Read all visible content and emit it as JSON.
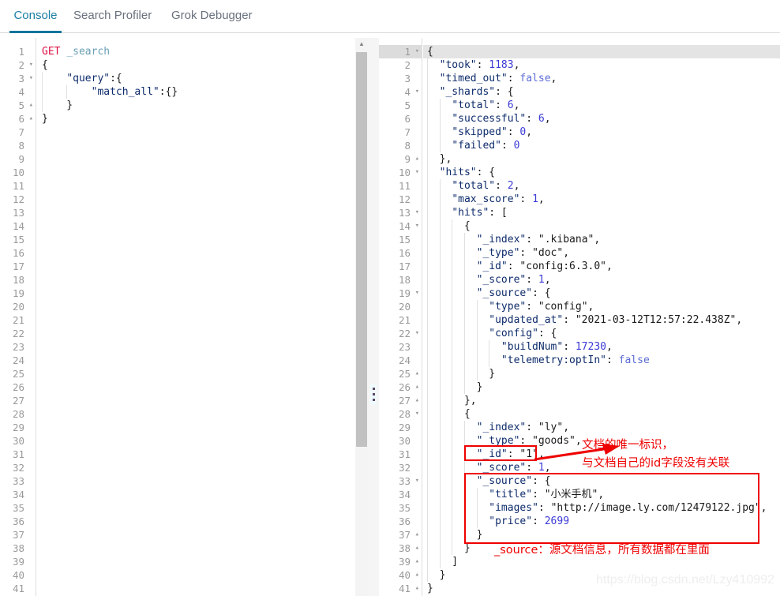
{
  "tabs": [
    {
      "label": "Console",
      "active": true
    },
    {
      "label": "Search Profiler",
      "active": false
    },
    {
      "label": "Grok Debugger",
      "active": false
    }
  ],
  "accent_color": "#0f769c",
  "annotation_color": "#ee0000",
  "request_editor": {
    "name": "console-request-editor",
    "total_lines": 41,
    "lines": [
      {
        "n": 1,
        "fold": "",
        "tokens": [
          {
            "t": "GET ",
            "c": "met"
          },
          {
            "t": "_search",
            "c": "url"
          }
        ]
      },
      {
        "n": 2,
        "fold": "▾",
        "tokens": [
          {
            "t": "{",
            "c": "p"
          }
        ]
      },
      {
        "n": 3,
        "fold": "▾",
        "tokens": [
          {
            "t": "    ",
            "c": "p"
          },
          {
            "t": "\"query\"",
            "c": "k"
          },
          {
            "t": ":{",
            "c": "p"
          }
        ]
      },
      {
        "n": 4,
        "fold": "",
        "tokens": [
          {
            "t": "        ",
            "c": "p"
          },
          {
            "t": "\"match_all\"",
            "c": "k"
          },
          {
            "t": ":{}",
            "c": "p"
          }
        ]
      },
      {
        "n": 5,
        "fold": "▴",
        "tokens": [
          {
            "t": "    }",
            "c": "p"
          }
        ]
      },
      {
        "n": 6,
        "fold": "▴",
        "tokens": [
          {
            "t": "}",
            "c": "p"
          }
        ]
      },
      {
        "n": 7,
        "fold": "",
        "tokens": []
      },
      {
        "n": 8,
        "fold": "",
        "tokens": []
      },
      {
        "n": 9,
        "fold": "",
        "tokens": []
      },
      {
        "n": 10,
        "fold": "",
        "tokens": []
      },
      {
        "n": 11,
        "fold": "",
        "tokens": []
      },
      {
        "n": 12,
        "fold": "",
        "tokens": []
      },
      {
        "n": 13,
        "fold": "",
        "tokens": []
      },
      {
        "n": 14,
        "fold": "",
        "tokens": []
      },
      {
        "n": 15,
        "fold": "",
        "tokens": []
      },
      {
        "n": 16,
        "fold": "",
        "tokens": []
      },
      {
        "n": 17,
        "fold": "",
        "tokens": []
      },
      {
        "n": 18,
        "fold": "",
        "tokens": []
      },
      {
        "n": 19,
        "fold": "",
        "tokens": []
      },
      {
        "n": 20,
        "fold": "",
        "tokens": []
      },
      {
        "n": 21,
        "fold": "",
        "tokens": []
      },
      {
        "n": 22,
        "fold": "",
        "tokens": []
      },
      {
        "n": 23,
        "fold": "",
        "tokens": []
      },
      {
        "n": 24,
        "fold": "",
        "tokens": []
      },
      {
        "n": 25,
        "fold": "",
        "tokens": []
      },
      {
        "n": 26,
        "fold": "",
        "tokens": []
      },
      {
        "n": 27,
        "fold": "",
        "tokens": []
      },
      {
        "n": 28,
        "fold": "",
        "tokens": []
      },
      {
        "n": 29,
        "fold": "",
        "tokens": []
      },
      {
        "n": 30,
        "fold": "",
        "tokens": []
      },
      {
        "n": 31,
        "fold": "",
        "tokens": []
      },
      {
        "n": 32,
        "fold": "",
        "tokens": []
      },
      {
        "n": 33,
        "fold": "",
        "tokens": []
      },
      {
        "n": 34,
        "fold": "",
        "tokens": []
      },
      {
        "n": 35,
        "fold": "",
        "tokens": []
      },
      {
        "n": 36,
        "fold": "",
        "tokens": []
      },
      {
        "n": 37,
        "fold": "",
        "tokens": []
      },
      {
        "n": 38,
        "fold": "",
        "tokens": []
      },
      {
        "n": 39,
        "fold": "",
        "tokens": []
      },
      {
        "n": 40,
        "fold": "",
        "tokens": []
      },
      {
        "n": 41,
        "fold": "",
        "tokens": []
      }
    ]
  },
  "response_editor": {
    "name": "console-response-editor",
    "total_lines": 41,
    "active_line": 1,
    "lines": [
      {
        "n": 1,
        "fold": "▾",
        "tokens": [
          {
            "t": "{",
            "c": "p"
          }
        ]
      },
      {
        "n": 2,
        "fold": "",
        "tokens": [
          {
            "t": "  ",
            "c": "p"
          },
          {
            "t": "\"took\"",
            "c": "k"
          },
          {
            "t": ": ",
            "c": "p"
          },
          {
            "t": "1183",
            "c": "num"
          },
          {
            "t": ",",
            "c": "p"
          }
        ]
      },
      {
        "n": 3,
        "fold": "",
        "tokens": [
          {
            "t": "  ",
            "c": "p"
          },
          {
            "t": "\"timed_out\"",
            "c": "k"
          },
          {
            "t": ": ",
            "c": "p"
          },
          {
            "t": "false",
            "c": "bool"
          },
          {
            "t": ",",
            "c": "p"
          }
        ]
      },
      {
        "n": 4,
        "fold": "▾",
        "tokens": [
          {
            "t": "  ",
            "c": "p"
          },
          {
            "t": "\"_shards\"",
            "c": "k"
          },
          {
            "t": ": {",
            "c": "p"
          }
        ]
      },
      {
        "n": 5,
        "fold": "",
        "tokens": [
          {
            "t": "    ",
            "c": "p"
          },
          {
            "t": "\"total\"",
            "c": "k"
          },
          {
            "t": ": ",
            "c": "p"
          },
          {
            "t": "6",
            "c": "num"
          },
          {
            "t": ",",
            "c": "p"
          }
        ]
      },
      {
        "n": 6,
        "fold": "",
        "tokens": [
          {
            "t": "    ",
            "c": "p"
          },
          {
            "t": "\"successful\"",
            "c": "k"
          },
          {
            "t": ": ",
            "c": "p"
          },
          {
            "t": "6",
            "c": "num"
          },
          {
            "t": ",",
            "c": "p"
          }
        ]
      },
      {
        "n": 7,
        "fold": "",
        "tokens": [
          {
            "t": "    ",
            "c": "p"
          },
          {
            "t": "\"skipped\"",
            "c": "k"
          },
          {
            "t": ": ",
            "c": "p"
          },
          {
            "t": "0",
            "c": "num"
          },
          {
            "t": ",",
            "c": "p"
          }
        ]
      },
      {
        "n": 8,
        "fold": "",
        "tokens": [
          {
            "t": "    ",
            "c": "p"
          },
          {
            "t": "\"failed\"",
            "c": "k"
          },
          {
            "t": ": ",
            "c": "p"
          },
          {
            "t": "0",
            "c": "num"
          }
        ]
      },
      {
        "n": 9,
        "fold": "▴",
        "tokens": [
          {
            "t": "  },",
            "c": "p"
          }
        ]
      },
      {
        "n": 10,
        "fold": "▾",
        "tokens": [
          {
            "t": "  ",
            "c": "p"
          },
          {
            "t": "\"hits\"",
            "c": "k"
          },
          {
            "t": ": {",
            "c": "p"
          }
        ]
      },
      {
        "n": 11,
        "fold": "",
        "tokens": [
          {
            "t": "    ",
            "c": "p"
          },
          {
            "t": "\"total\"",
            "c": "k"
          },
          {
            "t": ": ",
            "c": "p"
          },
          {
            "t": "2",
            "c": "num"
          },
          {
            "t": ",",
            "c": "p"
          }
        ]
      },
      {
        "n": 12,
        "fold": "",
        "tokens": [
          {
            "t": "    ",
            "c": "p"
          },
          {
            "t": "\"max_score\"",
            "c": "k"
          },
          {
            "t": ": ",
            "c": "p"
          },
          {
            "t": "1",
            "c": "num"
          },
          {
            "t": ",",
            "c": "p"
          }
        ]
      },
      {
        "n": 13,
        "fold": "▾",
        "tokens": [
          {
            "t": "    ",
            "c": "p"
          },
          {
            "t": "\"hits\"",
            "c": "k"
          },
          {
            "t": ": [",
            "c": "p"
          }
        ]
      },
      {
        "n": 14,
        "fold": "▾",
        "tokens": [
          {
            "t": "      {",
            "c": "p"
          }
        ]
      },
      {
        "n": 15,
        "fold": "",
        "tokens": [
          {
            "t": "        ",
            "c": "p"
          },
          {
            "t": "\"_index\"",
            "c": "k"
          },
          {
            "t": ": ",
            "c": "p"
          },
          {
            "t": "\".kibana\"",
            "c": "s"
          },
          {
            "t": ",",
            "c": "p"
          }
        ]
      },
      {
        "n": 16,
        "fold": "",
        "tokens": [
          {
            "t": "        ",
            "c": "p"
          },
          {
            "t": "\"_type\"",
            "c": "k"
          },
          {
            "t": ": ",
            "c": "p"
          },
          {
            "t": "\"doc\"",
            "c": "s"
          },
          {
            "t": ",",
            "c": "p"
          }
        ]
      },
      {
        "n": 17,
        "fold": "",
        "tokens": [
          {
            "t": "        ",
            "c": "p"
          },
          {
            "t": "\"_id\"",
            "c": "k"
          },
          {
            "t": ": ",
            "c": "p"
          },
          {
            "t": "\"config:6.3.0\"",
            "c": "s"
          },
          {
            "t": ",",
            "c": "p"
          }
        ]
      },
      {
        "n": 18,
        "fold": "",
        "tokens": [
          {
            "t": "        ",
            "c": "p"
          },
          {
            "t": "\"_score\"",
            "c": "k"
          },
          {
            "t": ": ",
            "c": "p"
          },
          {
            "t": "1",
            "c": "num"
          },
          {
            "t": ",",
            "c": "p"
          }
        ]
      },
      {
        "n": 19,
        "fold": "▾",
        "tokens": [
          {
            "t": "        ",
            "c": "p"
          },
          {
            "t": "\"_source\"",
            "c": "k"
          },
          {
            "t": ": {",
            "c": "p"
          }
        ]
      },
      {
        "n": 20,
        "fold": "",
        "tokens": [
          {
            "t": "          ",
            "c": "p"
          },
          {
            "t": "\"type\"",
            "c": "k"
          },
          {
            "t": ": ",
            "c": "p"
          },
          {
            "t": "\"config\"",
            "c": "s"
          },
          {
            "t": ",",
            "c": "p"
          }
        ]
      },
      {
        "n": 21,
        "fold": "",
        "tokens": [
          {
            "t": "          ",
            "c": "p"
          },
          {
            "t": "\"updated_at\"",
            "c": "k"
          },
          {
            "t": ": ",
            "c": "p"
          },
          {
            "t": "\"2021-03-12T12:57:22.438Z\"",
            "c": "s"
          },
          {
            "t": ",",
            "c": "p"
          }
        ]
      },
      {
        "n": 22,
        "fold": "▾",
        "tokens": [
          {
            "t": "          ",
            "c": "p"
          },
          {
            "t": "\"config\"",
            "c": "k"
          },
          {
            "t": ": {",
            "c": "p"
          }
        ]
      },
      {
        "n": 23,
        "fold": "",
        "tokens": [
          {
            "t": "            ",
            "c": "p"
          },
          {
            "t": "\"buildNum\"",
            "c": "k"
          },
          {
            "t": ": ",
            "c": "p"
          },
          {
            "t": "17230",
            "c": "num"
          },
          {
            "t": ",",
            "c": "p"
          }
        ]
      },
      {
        "n": 24,
        "fold": "",
        "tokens": [
          {
            "t": "            ",
            "c": "p"
          },
          {
            "t": "\"telemetry:optIn\"",
            "c": "k"
          },
          {
            "t": ": ",
            "c": "p"
          },
          {
            "t": "false",
            "c": "bool"
          }
        ]
      },
      {
        "n": 25,
        "fold": "▴",
        "tokens": [
          {
            "t": "          }",
            "c": "p"
          }
        ]
      },
      {
        "n": 26,
        "fold": "▴",
        "tokens": [
          {
            "t": "        }",
            "c": "p"
          }
        ]
      },
      {
        "n": 27,
        "fold": "▴",
        "tokens": [
          {
            "t": "      },",
            "c": "p"
          }
        ]
      },
      {
        "n": 28,
        "fold": "▾",
        "tokens": [
          {
            "t": "      {",
            "c": "p"
          }
        ]
      },
      {
        "n": 29,
        "fold": "",
        "tokens": [
          {
            "t": "        ",
            "c": "p"
          },
          {
            "t": "\"_index\"",
            "c": "k"
          },
          {
            "t": ": ",
            "c": "p"
          },
          {
            "t": "\"ly\"",
            "c": "s"
          },
          {
            "t": ",",
            "c": "p"
          }
        ]
      },
      {
        "n": 30,
        "fold": "",
        "tokens": [
          {
            "t": "        ",
            "c": "p"
          },
          {
            "t": "\"_type\"",
            "c": "k"
          },
          {
            "t": ": ",
            "c": "p"
          },
          {
            "t": "\"goods\"",
            "c": "s"
          },
          {
            "t": ",",
            "c": "p"
          }
        ]
      },
      {
        "n": 31,
        "fold": "",
        "tokens": [
          {
            "t": "        ",
            "c": "p"
          },
          {
            "t": "\"_id\"",
            "c": "k"
          },
          {
            "t": ": ",
            "c": "p"
          },
          {
            "t": "\"1\"",
            "c": "s"
          },
          {
            "t": ",",
            "c": "p"
          }
        ]
      },
      {
        "n": 32,
        "fold": "",
        "tokens": [
          {
            "t": "        ",
            "c": "p"
          },
          {
            "t": "\"_score\"",
            "c": "k"
          },
          {
            "t": ": ",
            "c": "p"
          },
          {
            "t": "1",
            "c": "num"
          },
          {
            "t": ",",
            "c": "p"
          }
        ]
      },
      {
        "n": 33,
        "fold": "▾",
        "tokens": [
          {
            "t": "        ",
            "c": "p"
          },
          {
            "t": "\"_source\"",
            "c": "k"
          },
          {
            "t": ": {",
            "c": "p"
          }
        ]
      },
      {
        "n": 34,
        "fold": "",
        "tokens": [
          {
            "t": "          ",
            "c": "p"
          },
          {
            "t": "\"title\"",
            "c": "k"
          },
          {
            "t": ": ",
            "c": "p"
          },
          {
            "t": "\"小米手机\"",
            "c": "s"
          },
          {
            "t": ",",
            "c": "p"
          }
        ]
      },
      {
        "n": 35,
        "fold": "",
        "tokens": [
          {
            "t": "          ",
            "c": "p"
          },
          {
            "t": "\"images\"",
            "c": "k"
          },
          {
            "t": ": ",
            "c": "p"
          },
          {
            "t": "\"http://image.ly.com/12479122.jpg\"",
            "c": "s"
          },
          {
            "t": ",",
            "c": "p"
          }
        ]
      },
      {
        "n": 36,
        "fold": "",
        "tokens": [
          {
            "t": "          ",
            "c": "p"
          },
          {
            "t": "\"price\"",
            "c": "k"
          },
          {
            "t": ": ",
            "c": "p"
          },
          {
            "t": "2699",
            "c": "num"
          }
        ]
      },
      {
        "n": 37,
        "fold": "▴",
        "tokens": [
          {
            "t": "        }",
            "c": "p"
          }
        ]
      },
      {
        "n": 38,
        "fold": "▴",
        "tokens": [
          {
            "t": "      }",
            "c": "p"
          }
        ]
      },
      {
        "n": 39,
        "fold": "▴",
        "tokens": [
          {
            "t": "    ]",
            "c": "p"
          }
        ]
      },
      {
        "n": 40,
        "fold": "▴",
        "tokens": [
          {
            "t": "  }",
            "c": "p"
          }
        ]
      },
      {
        "n": 41,
        "fold": "▴",
        "tokens": [
          {
            "t": "}",
            "c": "p"
          }
        ]
      }
    ]
  },
  "annotations": {
    "id_note_line1": "文档的唯一标识，",
    "id_note_line2": "与文档自己的id字段没有关联",
    "source_note": "_source：源文档信息，所有数据都在里面"
  },
  "watermark": "https://blog.csdn.net/Lzy410992"
}
